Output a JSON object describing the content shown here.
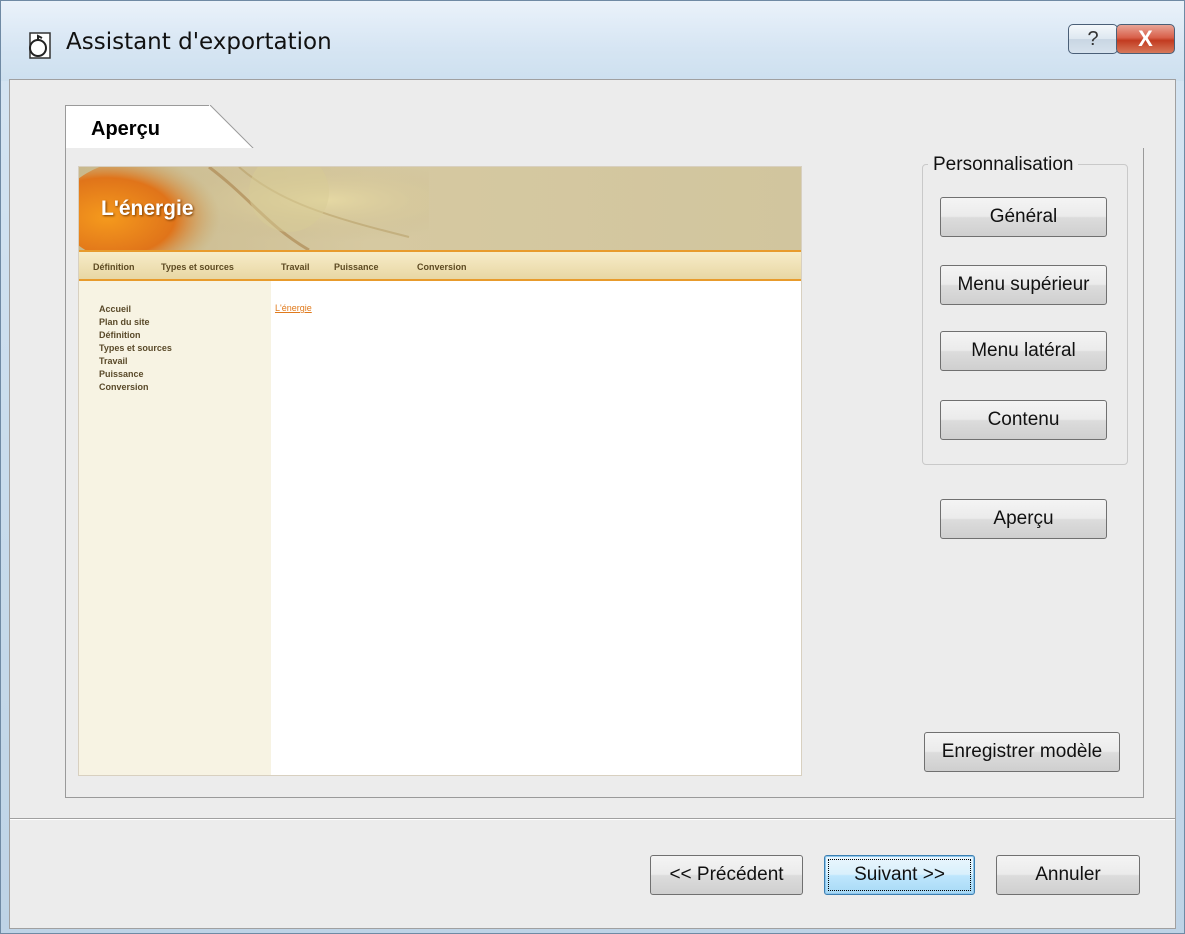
{
  "window": {
    "title": "Assistant d'exportation",
    "help_label": "?",
    "close_label": "X"
  },
  "tab": {
    "label": "Aperçu"
  },
  "preview": {
    "site_title": "L'énergie",
    "nav": [
      "Définition",
      "Types et sources",
      "Travail",
      "Puissance",
      "Conversion"
    ],
    "side_menu": [
      "Accueil",
      "Plan du site",
      "Définition",
      "Types et sources",
      "Travail",
      "Puissance",
      "Conversion"
    ],
    "content_link": "L'énergie",
    "accent_color": "#e89b2c"
  },
  "customization": {
    "legend": "Personnalisation",
    "general": "Général",
    "top_menu": "Menu supérieur",
    "side_menu": "Menu latéral",
    "content": "Contenu"
  },
  "actions": {
    "preview": "Aperçu",
    "save_template": "Enregistrer modèle",
    "previous": "<< Précédent",
    "next": "Suivant >>",
    "cancel": "Annuler"
  }
}
